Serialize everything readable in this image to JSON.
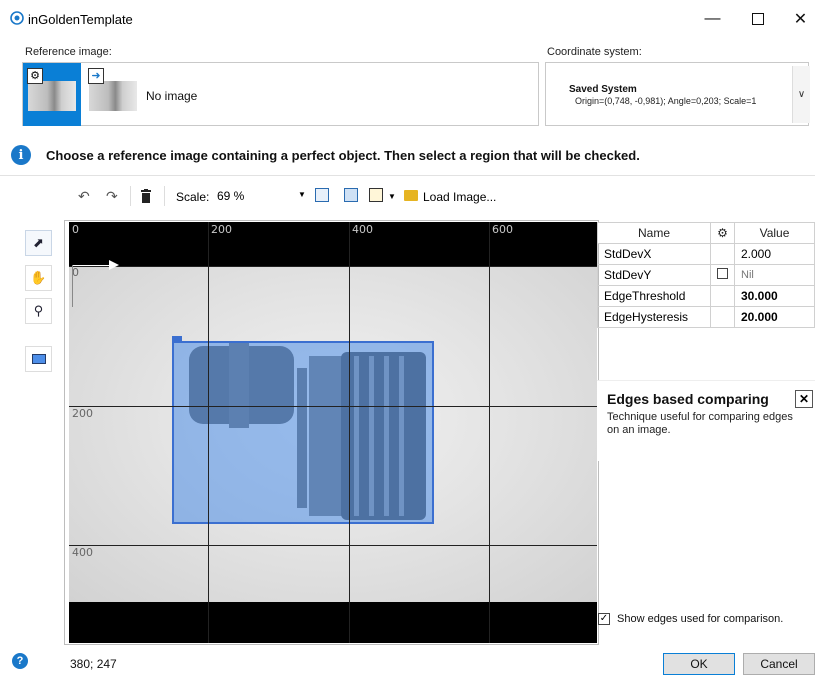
{
  "window": {
    "title": "inGoldenTemplate",
    "controls": [
      "minimize",
      "maximize",
      "close"
    ]
  },
  "reference": {
    "label": "Reference image:",
    "no_image": "No image"
  },
  "coordinate": {
    "label": "Coordinate system:",
    "system_name": "Saved System",
    "details": "Origin=(0,748, -0,981); Angle=0,203; Scale=1"
  },
  "info": {
    "text": "Choose a reference image containing a perfect object. Then select a region that will be checked."
  },
  "toolbar": {
    "scale_label": "Scale:",
    "scale_value": "69 %",
    "load_image": "Load Image..."
  },
  "ruler": {
    "x_ticks": [
      "0",
      "200",
      "400",
      "600"
    ],
    "y_ticks": [
      "0",
      "200",
      "400"
    ]
  },
  "properties": {
    "headers": {
      "name": "Name",
      "value": "Value"
    },
    "rows": [
      {
        "name": "StdDevX",
        "value": "2.000",
        "checkbox": false,
        "bold": false
      },
      {
        "name": "StdDevY",
        "value": "Nil",
        "checkbox": true,
        "bold": false
      },
      {
        "name": "EdgeThreshold",
        "value": "30.000",
        "checkbox": false,
        "bold": true
      },
      {
        "name": "EdgeHysteresis",
        "value": "20.000",
        "checkbox": false,
        "bold": true
      }
    ]
  },
  "help": {
    "title": "Edges based comparing",
    "body": "Technique useful for comparing edges on an image."
  },
  "show_edges": {
    "label": "Show edges used for comparison.",
    "checked": true
  },
  "footer": {
    "coords": "380; 247",
    "ok": "OK",
    "cancel": "Cancel"
  },
  "colors": {
    "accent": "#0a7fd6",
    "info": "#1a78c9",
    "region_fill": "#4d8ee8",
    "canvas_bg": "#000000"
  }
}
